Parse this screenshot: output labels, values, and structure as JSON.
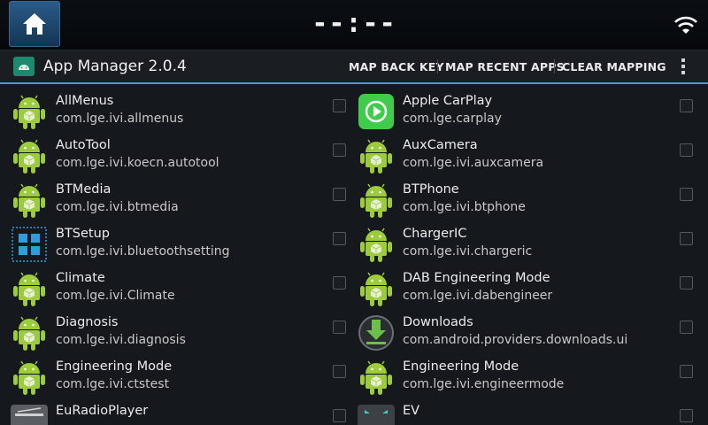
{
  "statusbar": {
    "clock": "--:--",
    "home_icon": "home-icon",
    "wifi_icon": "wifi-icon"
  },
  "actionbar": {
    "title": "App Manager 2.0.4",
    "menu": [
      "MAP BACK KEY",
      "MAP RECENT APPS",
      "CLEAR MAPPING"
    ],
    "overflow_icon": "overflow-menu-icon"
  },
  "colors": {
    "accent": "#33a5cf",
    "android_green": "#9ccc3b",
    "carplay_green": "#3ecc4a",
    "btsetup_blue": "#2b9fe0"
  },
  "apps_left": [
    {
      "name": "AllMenus",
      "package": "com.lge.ivi.allmenus",
      "icon": "android-icon"
    },
    {
      "name": "AutoTool",
      "package": "com.lge.ivi.koecn.autotool",
      "icon": "android-icon"
    },
    {
      "name": "BTMedia",
      "package": "com.lge.ivi.btmedia",
      "icon": "android-icon"
    },
    {
      "name": "BTSetup",
      "package": "com.lge.ivi.bluetoothsetting",
      "icon": "grid-icon"
    },
    {
      "name": "Climate",
      "package": "com.lge.ivi.Climate",
      "icon": "android-icon"
    },
    {
      "name": "Diagnosis",
      "package": "com.lge.ivi.diagnosis",
      "icon": "android-icon"
    },
    {
      "name": "Engineering Mode",
      "package": "com.lge.ivi.ctstest",
      "icon": "android-icon"
    },
    {
      "name": "EuRadioPlayer",
      "package": "",
      "icon": "radio-icon"
    }
  ],
  "apps_right": [
    {
      "name": "Apple CarPlay",
      "package": "com.lge.carplay",
      "icon": "carplay-icon"
    },
    {
      "name": "AuxCamera",
      "package": "com.lge.ivi.auxcamera",
      "icon": "android-icon"
    },
    {
      "name": "BTPhone",
      "package": "com.lge.ivi.btphone",
      "icon": "android-icon"
    },
    {
      "name": "ChargerIC",
      "package": "com.lge.ivi.chargeric",
      "icon": "android-icon"
    },
    {
      "name": "DAB Engineering Mode",
      "package": "com.lge.ivi.dabengineer",
      "icon": "android-icon"
    },
    {
      "name": "Downloads",
      "package": "com.android.providers.downloads.ui",
      "icon": "download-icon"
    },
    {
      "name": "Engineering Mode",
      "package": "com.lge.ivi.engineermode",
      "icon": "android-icon"
    },
    {
      "name": "EV",
      "package": "",
      "icon": "ev-icon"
    }
  ]
}
